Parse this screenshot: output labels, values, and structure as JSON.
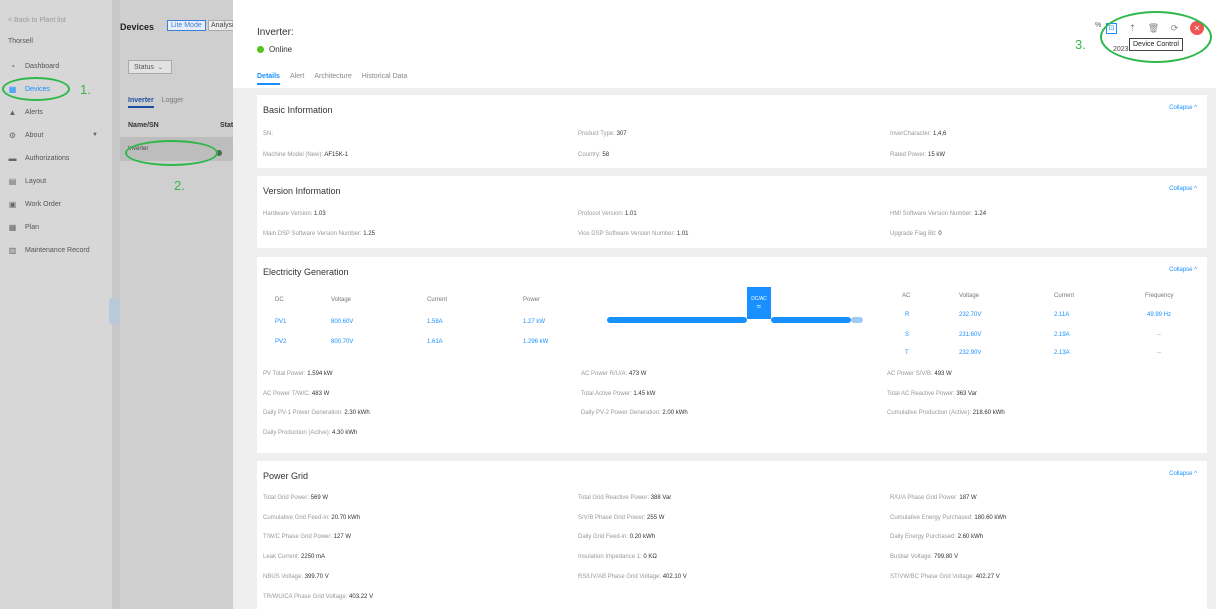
{
  "sidebar": {
    "back": "< Back to Plant list",
    "plant": "Thorsell",
    "items": [
      {
        "label": "Dashboard",
        "icon": "dashboard-icon"
      },
      {
        "label": "Devices",
        "icon": "devices-icon"
      },
      {
        "label": "Alerts",
        "icon": "alert-icon"
      },
      {
        "label": "About",
        "icon": "about-icon"
      },
      {
        "label": "Authorizations",
        "icon": "authorizations-icon"
      },
      {
        "label": "Layout",
        "icon": "layout-icon"
      },
      {
        "label": "Work Order",
        "icon": "work-order-icon"
      },
      {
        "label": "Plan",
        "icon": "plan-icon"
      },
      {
        "label": "Maintenance Record",
        "icon": "maintenance-icon"
      }
    ]
  },
  "middle": {
    "title": "Devices",
    "lite_mode": "Lite Mode",
    "analysis": "Analysis",
    "status_filter": "Status",
    "tabs": [
      "Inverter",
      "Logger"
    ],
    "col_name": "Name/SN",
    "col_status": "Status",
    "device_name": "Inverter"
  },
  "annotations": {
    "a1": "1.",
    "a2": "2.",
    "a3": "3."
  },
  "header": {
    "title": "Inverter:",
    "status": "Online",
    "tabs": [
      "Details",
      "Alert",
      "Architecture",
      "Historical Data"
    ],
    "pct": "%",
    "tooltip": "Device Control",
    "timestamp": "2023-...+01:00"
  },
  "basic": {
    "title": "Basic Information",
    "collapse": "Collapse ^",
    "sn_label": "SN:",
    "product_type_label": "Product Type:",
    "product_type": "307",
    "inver_char_label": "InverCharacter:",
    "inver_char": "1,4,6",
    "model_label": "Machine Model (New):",
    "model": "AF15K-1",
    "country_label": "Country:",
    "country": "58",
    "rated_power_label": "Rated Power:",
    "rated_power": "15 kW"
  },
  "version": {
    "title": "Version Information",
    "collapse": "Collapse ^",
    "hw_label": "Hardware Version:",
    "hw": "1.03",
    "protocol_label": "Protocol Version:",
    "protocol": "1.01",
    "hmi_label": "HMI Software Version Number:",
    "hmi": "1.24",
    "main_dsp_label": "Main DSP Software Version Number:",
    "main_dsp": "1.25",
    "vice_dsp_label": "Vice DSP Software Version Number:",
    "vice_dsp": "1.01",
    "upgrade_label": "Upgrade Flag Bit:",
    "upgrade": "0"
  },
  "generation": {
    "title": "Electricity Generation",
    "collapse": "Collapse ^",
    "dc_head": [
      "DC",
      "Voltage",
      "Current",
      "Power"
    ],
    "pv": [
      {
        "name": "PV1",
        "voltage": "800.60V",
        "current": "1.58A",
        "power": "1.27 kW"
      },
      {
        "name": "PV2",
        "voltage": "800.70V",
        "current": "1.61A",
        "power": "1.296 kW"
      }
    ],
    "converter": "DC/AC",
    "ac_head": [
      "AC",
      "Voltage",
      "Current",
      "Frequency"
    ],
    "ac": [
      {
        "name": "R",
        "voltage": "232.70V",
        "current": "2.11A",
        "freq": "49.99 Hz"
      },
      {
        "name": "S",
        "voltage": "231.60V",
        "current": "2.19A",
        "freq": "--"
      },
      {
        "name": "T",
        "voltage": "232.90V",
        "current": "2.13A",
        "freq": "--"
      }
    ],
    "stats": [
      {
        "label": "PV Total Power:",
        "value": "1.594 kW"
      },
      {
        "label": "AC Power R/U/A:",
        "value": "473 W"
      },
      {
        "label": "AC Power S/V/B:",
        "value": "493 W"
      },
      {
        "label": "AC Power T/W/C:",
        "value": "483 W"
      },
      {
        "label": "Total Active Power:",
        "value": "1.45 kW"
      },
      {
        "label": "Total AC Reactive Power:",
        "value": "363 Var"
      },
      {
        "label": "Daily PV-1 Power Generation:",
        "value": "2.30 kWh"
      },
      {
        "label": "Daily PV-2 Power Generation:",
        "value": "2.00 kWh"
      },
      {
        "label": "Cumulative Production (Active):",
        "value": "218.60 kWh"
      },
      {
        "label": "Daily Production (Active):",
        "value": "4.30 kWh"
      }
    ]
  },
  "grid": {
    "title": "Power Grid",
    "collapse": "Collapse ^",
    "stats": [
      {
        "label": "Total Grid Power:",
        "value": "569 W"
      },
      {
        "label": "Total Grid Reactive Power:",
        "value": "388 Var"
      },
      {
        "label": "R/U/A Phase Grid Power:",
        "value": "187 W"
      },
      {
        "label": "Cumulative Grid Feed-in:",
        "value": "20.70 kWh"
      },
      {
        "label": "S/V/B Phase Grid Power:",
        "value": "255 W"
      },
      {
        "label": "Cumulative Energy Purchased:",
        "value": "180.60 kWh"
      },
      {
        "label": "T/W/C Phase Grid Power:",
        "value": "127 W"
      },
      {
        "label": "Daily Grid Feed-in:",
        "value": "0.20 kWh"
      },
      {
        "label": "Daily Energy Purchased:",
        "value": "2.60 kWh"
      },
      {
        "label": "Leak Current:",
        "value": "2250 mA"
      },
      {
        "label": "Insulation Impedance 1:",
        "value": "0 KΩ"
      },
      {
        "label": "Busbar Voltage:",
        "value": "799.80 V"
      },
      {
        "label": "NBUS Voltage:",
        "value": "399.70 V"
      },
      {
        "label": "RS/UV/AB Phase Grid Voltage:",
        "value": "402.10 V"
      },
      {
        "label": "ST/VW/BC Phase Grid Voltage:",
        "value": "402.27 V"
      },
      {
        "label": "TR/WU/CA Phase Grid Voltage:",
        "value": "403.22 V"
      }
    ]
  }
}
